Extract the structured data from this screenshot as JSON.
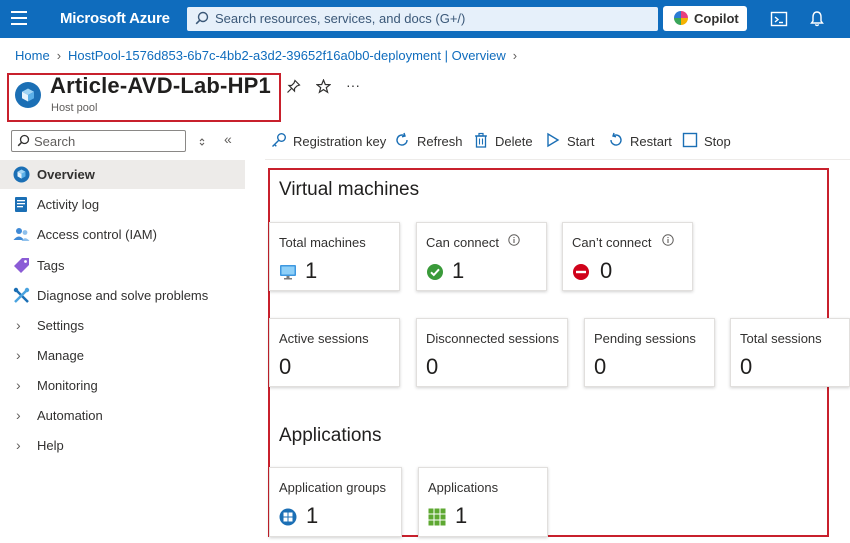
{
  "topbar": {
    "brand": "Microsoft Azure",
    "search_placeholder": "Search resources, services, and docs (G+/)",
    "copilot_label": "Copilot"
  },
  "breadcrumb": {
    "home": "Home",
    "deployment": "HostPool-1576d853-6b7c-4bb2-a3d2-39652f16a0b0-deployment | Overview"
  },
  "resource": {
    "title": "Article-AVD-Lab-HP1",
    "subtitle": "Host pool",
    "more": "···"
  },
  "sidebar": {
    "search_placeholder": "Search",
    "collapse": "«",
    "items": [
      {
        "label": "Overview",
        "icon": "host-pool-icon",
        "selected": true
      },
      {
        "label": "Activity log",
        "icon": "activity-log-icon"
      },
      {
        "label": "Access control (IAM)",
        "icon": "iam-icon"
      },
      {
        "label": "Tags",
        "icon": "tag-icon"
      },
      {
        "label": "Diagnose and solve problems",
        "icon": "wrench-icon"
      },
      {
        "label": "Settings",
        "icon": "chevron-right-icon"
      },
      {
        "label": "Manage",
        "icon": "chevron-right-icon"
      },
      {
        "label": "Monitoring",
        "icon": "chevron-right-icon"
      },
      {
        "label": "Automation",
        "icon": "chevron-right-icon"
      },
      {
        "label": "Help",
        "icon": "chevron-right-icon"
      }
    ]
  },
  "toolbar": {
    "registration_key": "Registration key",
    "refresh": "Refresh",
    "delete": "Delete",
    "start": "Start",
    "restart": "Restart",
    "stop": "Stop"
  },
  "virtual_machines": {
    "title": "Virtual machines",
    "total_machines": {
      "label": "Total machines",
      "value": "1"
    },
    "can_connect": {
      "label": "Can connect",
      "value": "1"
    },
    "cant_connect": {
      "label": "Can’t connect",
      "value": "0"
    }
  },
  "sessions": {
    "active": {
      "label": "Active sessions",
      "value": "0"
    },
    "disconnected": {
      "label": "Disconnected sessions",
      "value": "0"
    },
    "pending": {
      "label": "Pending sessions",
      "value": "0"
    },
    "total": {
      "label": "Total sessions",
      "value": "0"
    }
  },
  "applications": {
    "title": "Applications",
    "groups": {
      "label": "Application groups",
      "value": "1"
    },
    "apps": {
      "label": "Applications",
      "value": "1"
    }
  },
  "colors": {
    "azure_blue": "#0f6cbd",
    "highlight_red": "#c8202c",
    "success_green": "#3a9a3a",
    "error_red": "#d0021b"
  }
}
